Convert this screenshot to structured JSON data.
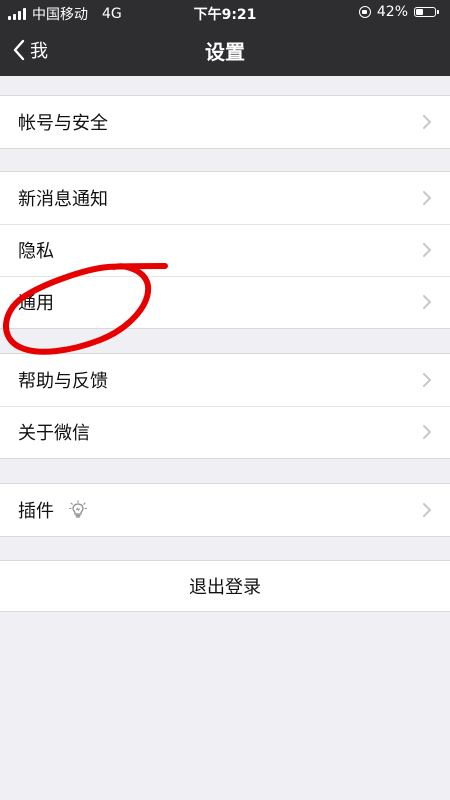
{
  "status_bar": {
    "carrier": "中国移动",
    "network": "4G",
    "time": "下午9:21",
    "battery_text": "42%",
    "battery_level": 0.42
  },
  "nav": {
    "back_label": "我",
    "title": "设置"
  },
  "groups": [
    {
      "items": [
        {
          "label": "帐号与安全"
        }
      ]
    },
    {
      "items": [
        {
          "label": "新消息通知"
        },
        {
          "label": "隐私"
        },
        {
          "label": "通用"
        }
      ]
    },
    {
      "items": [
        {
          "label": "帮助与反馈"
        },
        {
          "label": "关于微信"
        }
      ]
    },
    {
      "items": [
        {
          "label": "插件"
        }
      ]
    }
  ],
  "logout": {
    "label": "退出登录"
  },
  "colors": {
    "topbar": "#2e2e31",
    "background": "#efeff4",
    "annotation": "#e60000"
  }
}
